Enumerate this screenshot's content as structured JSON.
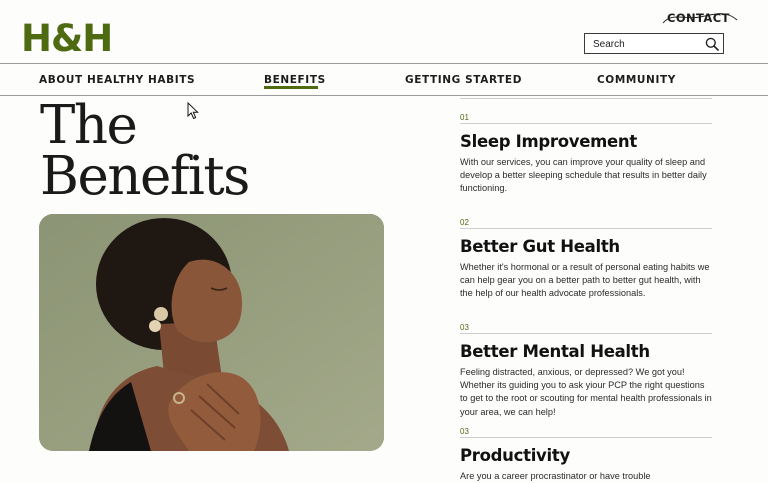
{
  "brand": {
    "logo_text": "H&H",
    "accent": "#4f6b12"
  },
  "header": {
    "contact_label": "CONTACT"
  },
  "search": {
    "placeholder": "Search"
  },
  "nav": {
    "items": [
      {
        "label": "ABOUT HEALTHY HABITS"
      },
      {
        "label": "BENEFITS",
        "active": true
      },
      {
        "label": "GETTING STARTED"
      },
      {
        "label": "COMMUNITY"
      }
    ]
  },
  "hero": {
    "title_line1": "The",
    "title_line2": "Benefits"
  },
  "benefits": [
    {
      "number": "01",
      "title": "Sleep Improvement",
      "description": "With our services, you can improve your quality of sleep and develop a better sleeping schedule that results in better daily functioning."
    },
    {
      "number": "02",
      "title": "Better Gut Health",
      "description": "Whether it's hormonal or a result of personal eating habits we can help gear you on a better path to better gut health, with the help of our health advocate professionals."
    },
    {
      "number": "03",
      "title": "Better Mental Health",
      "description": "Feeling distracted, anxious, or depressed? We got you! Whether its guiding you to ask yiour PCP the right questions to get to the root or scouting for mental health professionals in your area, we can help!"
    },
    {
      "number": "03",
      "title": "Productivity",
      "description": "Are you a career procrastinator or have trouble"
    }
  ]
}
